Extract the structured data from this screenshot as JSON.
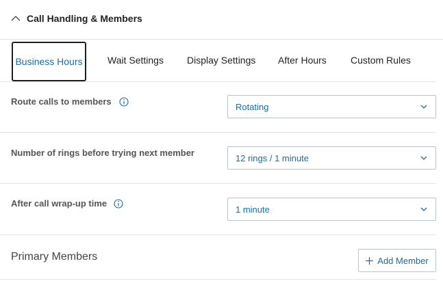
{
  "section": {
    "title": "Call Handling & Members",
    "collapse_icon": "chevron-up-icon"
  },
  "tabs": [
    {
      "label": "Business Hours",
      "active": true
    },
    {
      "label": "Wait Settings",
      "active": false
    },
    {
      "label": "Display Settings",
      "active": false
    },
    {
      "label": "After Hours",
      "active": false
    },
    {
      "label": "Custom Rules",
      "active": false
    }
  ],
  "settings": {
    "route_calls": {
      "label": "Route calls to members",
      "value": "Rotating",
      "has_info": true
    },
    "rings": {
      "label": "Number of rings before trying next member",
      "value": "12 rings / 1 minute",
      "has_info": false
    },
    "wrap_up": {
      "label": "After call wrap-up time",
      "value": "1 minute",
      "has_info": true
    }
  },
  "members": {
    "title": "Primary Members",
    "add_button_label": "Add Member"
  },
  "colors": {
    "accent": "#1a6aa8",
    "border": "#b9c4cc",
    "divider": "#e3e3e3"
  }
}
